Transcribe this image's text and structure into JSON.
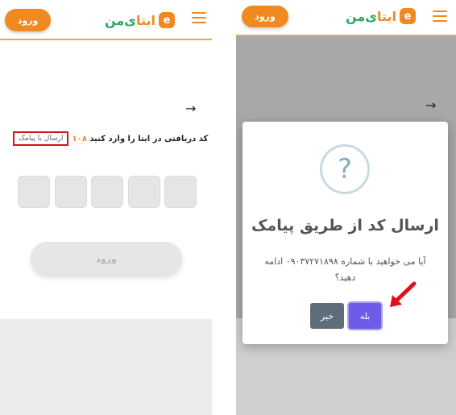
{
  "left_panel": {
    "header": {
      "login_label": "ورود",
      "logo_mark": "e",
      "logo_text_part1": "ایتا",
      "logo_text_part2": "ی‌من",
      "menu_icon": "hamburger-icon"
    },
    "back_arrow": "→",
    "code_prompt": "کد دریافتی در ایتا را وارد کنید",
    "timer": "۱۰۸",
    "sms_link_label": "ارسال با پیامک",
    "otp_boxes": [
      "",
      "",
      "",
      "",
      ""
    ],
    "submit_label": "ورود"
  },
  "right_panel": {
    "header": {
      "login_label": "ورود",
      "logo_mark": "e",
      "logo_text_part1": "ایتا",
      "logo_text_part2": "ی‌من",
      "menu_icon": "hamburger-icon"
    },
    "back_arrow": "→",
    "dialog": {
      "icon": "?",
      "title": "ارسال کد از طریق پیامک",
      "message": "آیا می خواهید با شماره ۰۹۰۳۷۲۷۱۸۹۸ ادامه دهید؟",
      "no_label": "خیر",
      "yes_label": "بله"
    },
    "annotation": "red-arrow-pointer"
  },
  "colors": {
    "accent_orange": "#f0891f",
    "brand_green": "#2aa86a",
    "confirm_purple": "#6c5ce7",
    "cancel_gray": "#5d6d79",
    "highlight_red": "#d0141e"
  }
}
